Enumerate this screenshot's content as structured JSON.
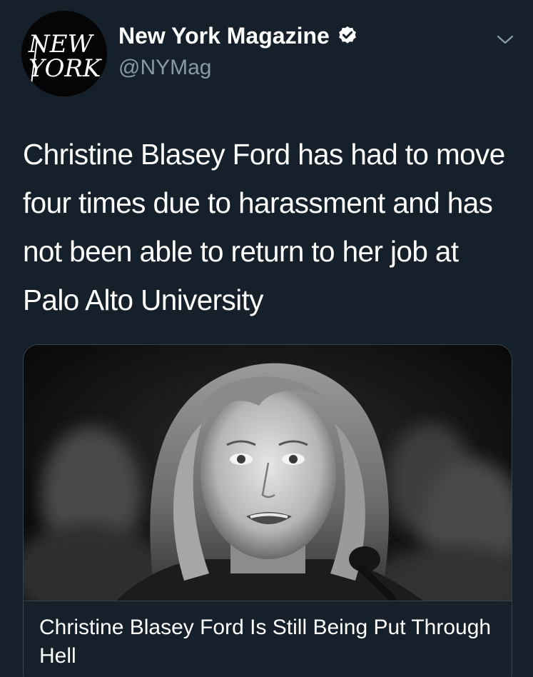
{
  "account": {
    "display_name": "New York Magazine",
    "handle": "@NYMag",
    "verified": true,
    "avatar": {
      "icon": "new-york-magazine-logo",
      "logo_line_1": "NEW",
      "logo_line_2": "YORK"
    }
  },
  "icons": {
    "verified": "verified-badge-icon",
    "menu": "chevron-down-icon"
  },
  "tweet": {
    "text": "Christine Blasey Ford has had to move four times due to harassment and has not been able to return to her job at Palo Alto University"
  },
  "link_card": {
    "image": "photo of Christine Blasey Ford speaking at a hearing",
    "title": "Christine Blasey Ford Is Still Being Put Through Hell"
  },
  "colors": {
    "background": "#15202b",
    "text_primary": "#ffffff",
    "text_secondary": "#8899a6",
    "border": "#38444d",
    "verified_badge": "#ffffff"
  }
}
